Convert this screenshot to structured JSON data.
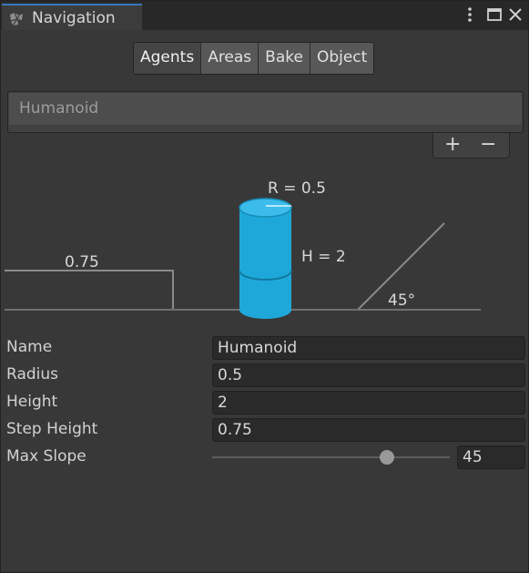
{
  "window": {
    "tab_title": "Navigation",
    "tab_icon": "navmesh-icon",
    "buttons": [
      "kebab-menu-icon",
      "maximize-icon",
      "close-icon"
    ]
  },
  "tabs": [
    {
      "label": "Agents",
      "active": true
    },
    {
      "label": "Areas",
      "active": false
    },
    {
      "label": "Bake",
      "active": false
    },
    {
      "label": "Object",
      "active": false
    }
  ],
  "agent_list": {
    "items": [
      "Humanoid"
    ],
    "add_label": "+",
    "remove_label": "−"
  },
  "diagram": {
    "radius_label": "R = 0.5",
    "height_label": "H = 2",
    "step_label": "0.75",
    "slope_label": "45°",
    "cylinder_color": "#1ea8da"
  },
  "fields": {
    "name": {
      "label": "Name",
      "value": "Humanoid"
    },
    "radius": {
      "label": "Radius",
      "value": "0.5"
    },
    "height": {
      "label": "Height",
      "value": "2"
    },
    "step_height": {
      "label": "Step Height",
      "value": "0.75"
    },
    "max_slope": {
      "label": "Max Slope",
      "value": "45",
      "min": 0,
      "max": 60,
      "slider_fraction": 0.75
    }
  }
}
